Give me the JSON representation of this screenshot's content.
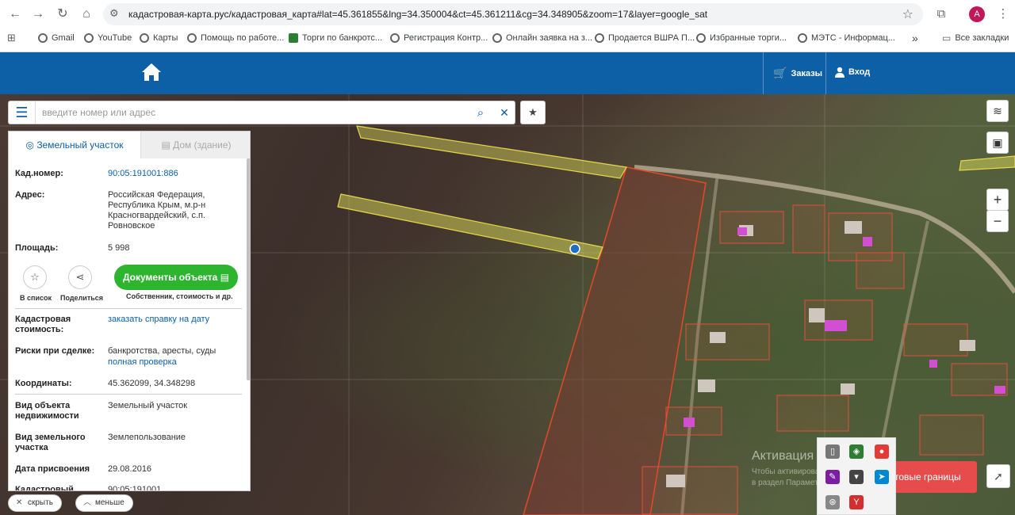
{
  "browser": {
    "url": "кадастровая-карта.рус/кадастровая_карта#lat=45.361855&lng=34.350004&ct=45.361211&cg=34.348905&zoom=17&layer=google_sat",
    "avatar_letter": "A",
    "bookmarks": [
      "Gmail",
      "YouTube",
      "Карты",
      "Помощь по работе...",
      "Торги по банкротс...",
      "Регистрация Контр...",
      "Онлайн заявка на з...",
      "Продается ВШРА П...",
      "Избранные торги...",
      "МЭТС - Информац..."
    ],
    "more_label": "»",
    "all_bookmarks": "Все закладки"
  },
  "header": {
    "orders_label": "Заказы",
    "login_label": "Вход",
    "bg_color": "#0d5fa6"
  },
  "search": {
    "placeholder": "введите номер или адрес"
  },
  "panel": {
    "tab_land": "Земельный участок",
    "tab_house": "Дом (здание)",
    "fields": {
      "cad_label": "Кад.номер:",
      "cad_value": "90:05:191001:886",
      "address_label": "Адрес:",
      "address_value": "Российская Федерация, Республика Крым, м.р-н Красногвардейский, с.п. Ровновское",
      "area_label": "Площадь:",
      "area_value": "5 998",
      "cad_cost_label": "Кадастровая стоимость:",
      "cad_cost_value": "заказать справку на дату",
      "risks_label": "Риски при сделке:",
      "risks_value": "банкротства, аресты, суды",
      "risks_link": "полная проверка",
      "coords_label": "Координаты:",
      "coords_value": "45.362099, 34.348298",
      "type_label": "Вид объекта недвижимости",
      "type_value": "Земельный участок",
      "land_type_label": "Вид земельного участка",
      "land_type_value": "Землепользование",
      "date_label": "Дата присвоения",
      "date_value": "29.08.2016",
      "quarter_label": "Кадастровый",
      "quarter_value": "90:05:191001"
    },
    "actions": {
      "to_list": "В список",
      "share": "Поделиться",
      "docs_button": "Документы объекта",
      "docs_sub": "Собственник, стоимость и др."
    }
  },
  "bottom": {
    "hide": "скрыть",
    "less": "меньше"
  },
  "map": {
    "boundaries_button": "товые границы",
    "watermark_title": "Активация Windows",
    "watermark_sub": "Чтобы активировать Windows, перейдите в раздел Параметры."
  }
}
